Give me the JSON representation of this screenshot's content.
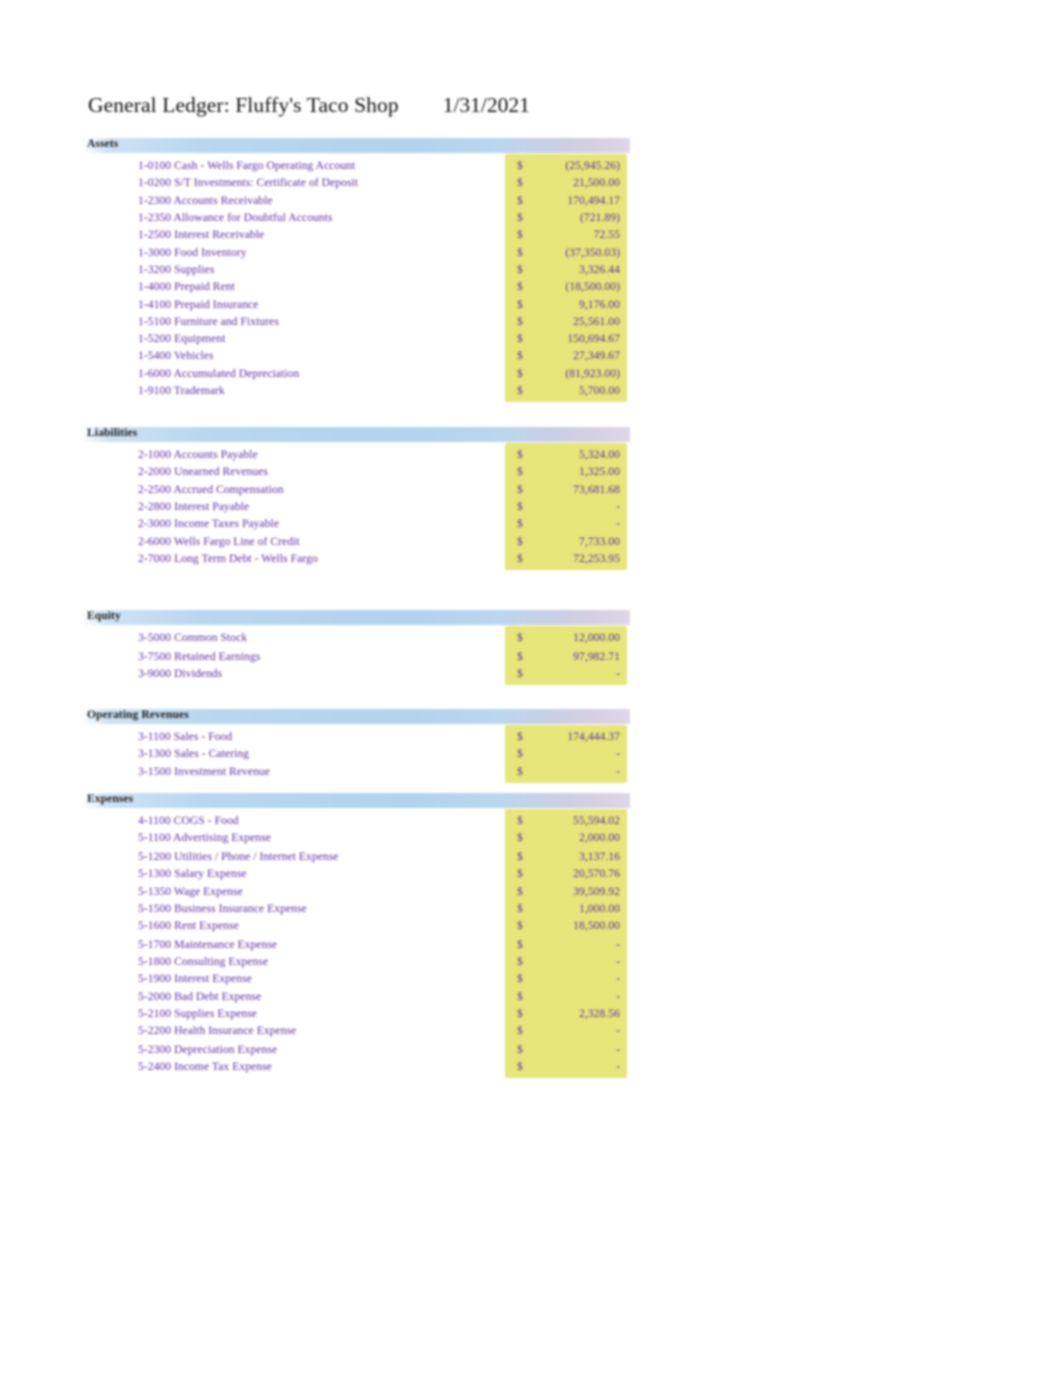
{
  "document": {
    "title": "General Ledger: Fluffy's Taco Shop",
    "date": "1/31/2021",
    "currency_symbol": "$",
    "zero_placeholder": "-"
  },
  "colors": {
    "account_text": "#5b2d9e",
    "section_header_blue": "#b2d3ee",
    "value_column_yellow": "#e6e67a",
    "title_text": "#101010",
    "page_background": "#ffffff"
  },
  "sections": [
    {
      "name": "Assets",
      "rows": [
        {
          "account": "1-0100 Cash - Wells Fargo Operating Account",
          "symbol": "$",
          "amount": "(25,945.26)"
        },
        {
          "account": "1-0200 S/T Investments: Certificate of Deposit",
          "symbol": "$",
          "amount": "21,500.00"
        },
        {
          "account": "1-2300 Accounts Receivable",
          "symbol": "$",
          "amount": "170,494.17"
        },
        {
          "account": "1-2350 Allowance for Doubtful Accounts",
          "symbol": "$",
          "amount": "(721.89)"
        },
        {
          "account": "1-2500 Interest Receivable",
          "symbol": "$",
          "amount": "72.55"
        },
        {
          "account": "1-3000 Food Inventory",
          "symbol": "$",
          "amount": "(37,350.03)"
        },
        {
          "account": "1-3200 Supplies",
          "symbol": "$",
          "amount": "3,326.44"
        },
        {
          "account": "1-4000 Prepaid Rent",
          "symbol": "$",
          "amount": "(18,500.00)"
        },
        {
          "account": "1-4100 Prepaid Insurance",
          "symbol": "$",
          "amount": "9,176.00"
        },
        {
          "account": "1-5100 Furniture and Fixtures",
          "symbol": "$",
          "amount": "25,561.00"
        },
        {
          "account": "1-5200 Equipment",
          "symbol": "$",
          "amount": "150,694.67"
        },
        {
          "account": "1-5400 Vehicles",
          "symbol": "$",
          "amount": "27,349.67"
        },
        {
          "account": "1-6000 Accumulated Depreciation",
          "symbol": "$",
          "amount": "(81,923.00)"
        },
        {
          "account": "1-9100 Trademark",
          "symbol": "$",
          "amount": "5,700.00"
        }
      ]
    },
    {
      "name": "Liabilities",
      "rows": [
        {
          "account": "2-1000 Accounts Payable",
          "symbol": "$",
          "amount": "5,324.00"
        },
        {
          "account": "2-2000 Unearned Revenues",
          "symbol": "$",
          "amount": "1,325.00"
        },
        {
          "account": "2-2500 Accrued Compensation",
          "symbol": "$",
          "amount": "73,681.68"
        },
        {
          "account": "2-2800 Interest Payable",
          "symbol": "$",
          "amount": "-"
        },
        {
          "account": "2-3000 Income Taxes Payable",
          "symbol": "$",
          "amount": "-"
        },
        {
          "account": "2-6000 Wells Fargo Line of Credit",
          "symbol": "$",
          "amount": "7,733.00"
        },
        {
          "account": "2-7000 Long Term Debt - Wells Fargo",
          "symbol": "$",
          "amount": "72,253.95"
        }
      ]
    },
    {
      "name": "Equity",
      "rows": [
        {
          "account": "3-5000 Common Stock",
          "symbol": "$",
          "amount": "12,000.00"
        },
        {
          "account": "3-7500 Retained Earnings",
          "symbol": "$",
          "amount": "97,982.71"
        },
        {
          "account": "3-9000 Dividends",
          "symbol": "$",
          "amount": "-"
        }
      ]
    },
    {
      "name": "Operating Revenues",
      "rows": [
        {
          "account": "3-1100 Sales - Food",
          "symbol": "$",
          "amount": "174,444.37"
        },
        {
          "account": "3-1300 Sales - Catering",
          "symbol": "$",
          "amount": "-"
        },
        {
          "account": "3-1500 Investment Revenue",
          "symbol": "$",
          "amount": "-"
        }
      ]
    },
    {
      "name": "Expenses",
      "rows": [
        {
          "account": "4-1100 COGS - Food",
          "symbol": "$",
          "amount": "55,594.02"
        },
        {
          "account": "5-1100 Advertising Expense",
          "symbol": "$",
          "amount": "2,000.00"
        },
        {
          "account": "5-1200 Utilities / Phone / Internet Expense",
          "symbol": "$",
          "amount": "3,137.16"
        },
        {
          "account": "5-1300 Salary Expense",
          "symbol": "$",
          "amount": "20,570.76"
        },
        {
          "account": "5-1350 Wage Expense",
          "symbol": "$",
          "amount": "39,509.92"
        },
        {
          "account": "5-1500 Business Insurance Expense",
          "symbol": "$",
          "amount": "1,000.00"
        },
        {
          "account": "5-1600 Rent Expense",
          "symbol": "$",
          "amount": "18,500.00"
        },
        {
          "account": "5-1700 Maintenance Expense",
          "symbol": "$",
          "amount": "-"
        },
        {
          "account": "5-1800 Consulting Expense",
          "symbol": "$",
          "amount": "-"
        },
        {
          "account": "5-1900 Interest Expense",
          "symbol": "$",
          "amount": "-"
        },
        {
          "account": "5-2000 Bad Debt Expense",
          "symbol": "$",
          "amount": "-"
        },
        {
          "account": "5-2100 Supplies Expense",
          "symbol": "$",
          "amount": "2,328.56"
        },
        {
          "account": "5-2200 Health Insurance Expense",
          "symbol": "$",
          "amount": "-"
        },
        {
          "account": "5-2300 Depreciation Expense",
          "symbol": "$",
          "amount": "-"
        },
        {
          "account": "5-2400 Income Tax Expense",
          "symbol": "$",
          "amount": "-"
        }
      ]
    }
  ]
}
